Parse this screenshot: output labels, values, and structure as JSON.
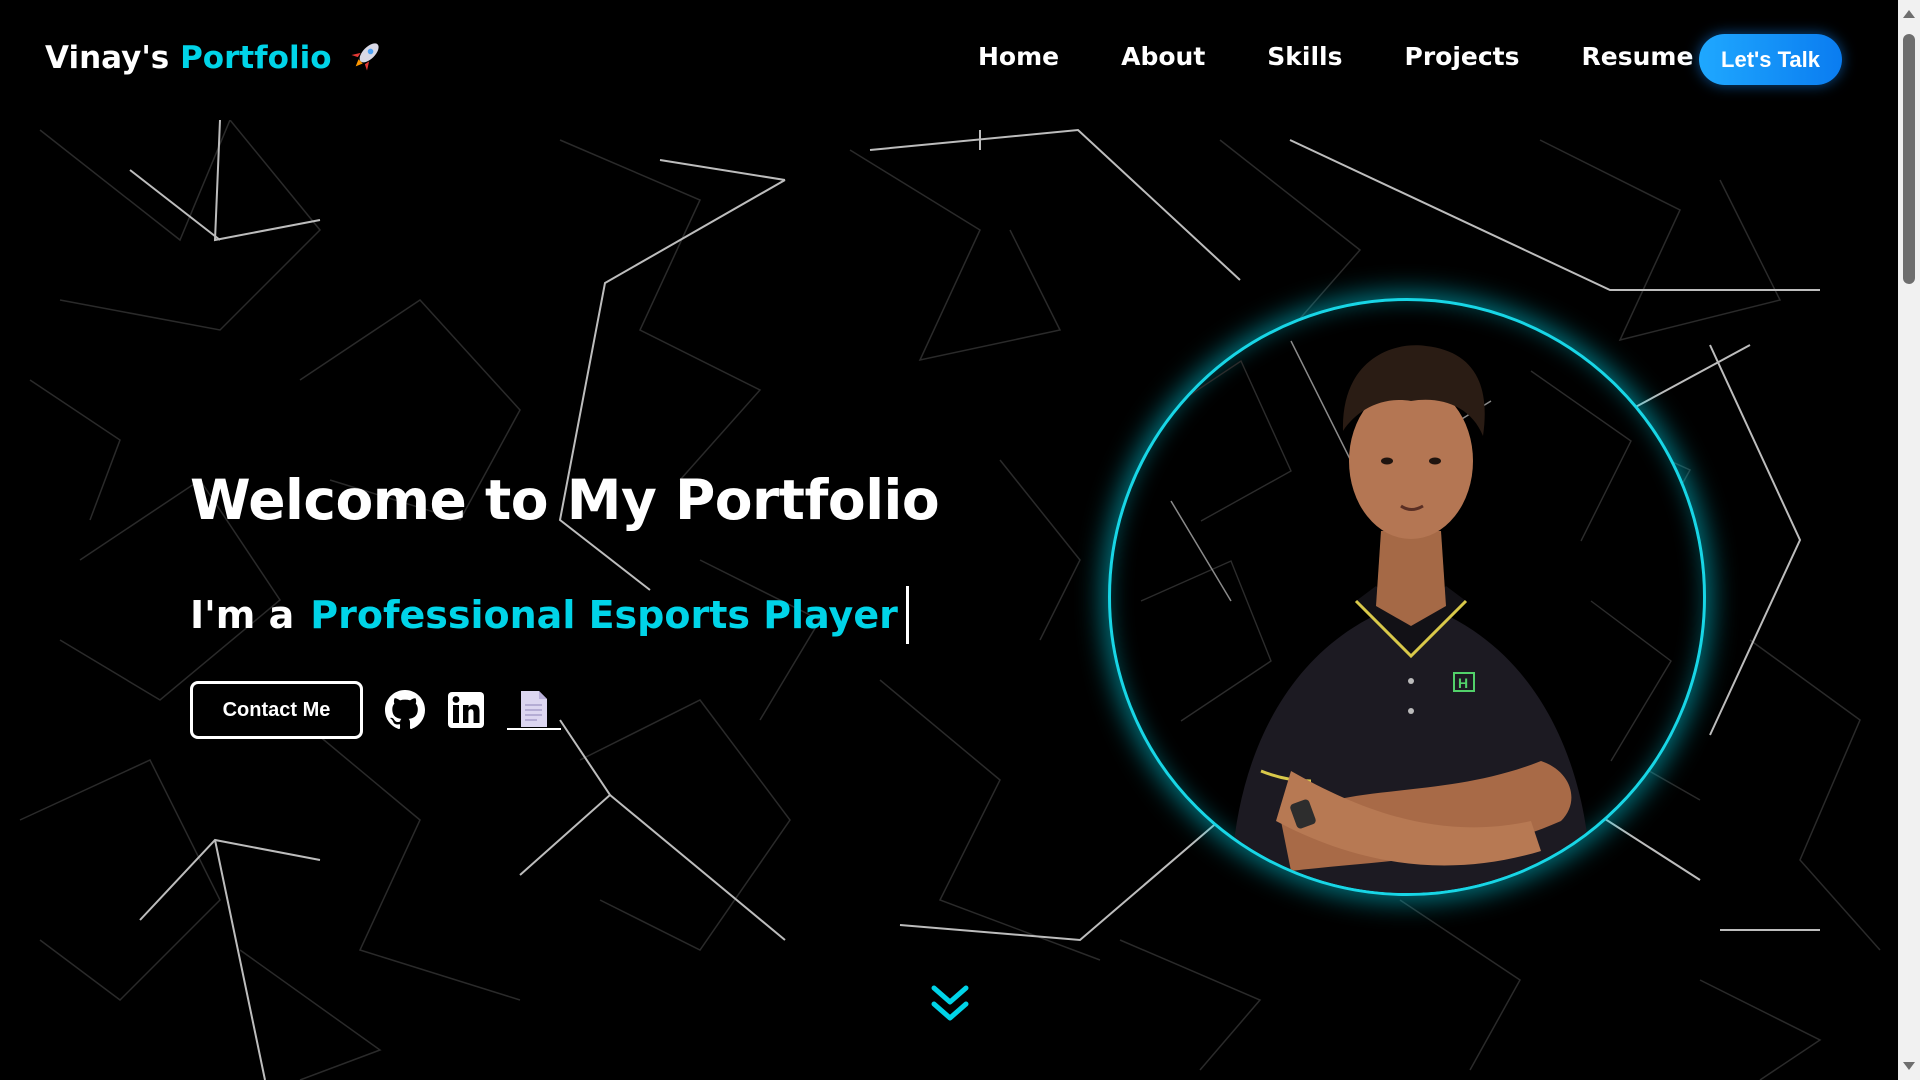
{
  "navbar": {
    "brand_name": "Vinay's",
    "brand_accent": "Portfolio",
    "brand_icon": "rocket-icon",
    "links": [
      "Home",
      "About",
      "Skills",
      "Projects",
      "Resume"
    ],
    "cta_label": "Let's Talk"
  },
  "hero": {
    "title": "Welcome to My Portfolio",
    "subtitle_prefix": "I'm a",
    "subtitle_role": "Professional Esports Player",
    "contact_label": "Contact Me",
    "social_icons": [
      "github-icon",
      "linkedin-icon",
      "document-icon"
    ]
  },
  "profile": {
    "image": "profile-photo"
  },
  "scroll_icon": "double-chevron-down-icon",
  "colors": {
    "background": "#000000",
    "accent": "#00d4e8",
    "cta": "#1488f7",
    "text": "#ffffff"
  }
}
